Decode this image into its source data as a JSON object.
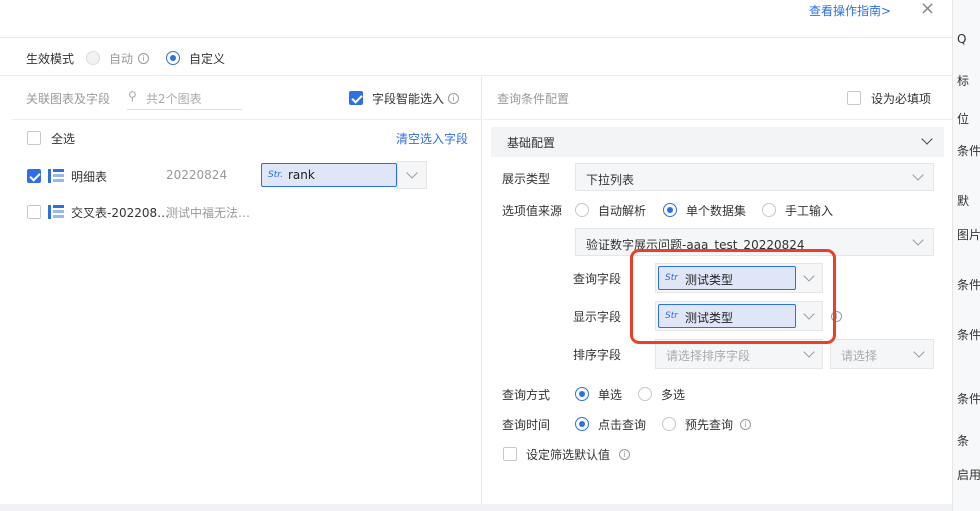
{
  "header": {
    "guide_link": "查看操作指南>",
    "close_icon": "×"
  },
  "mode": {
    "label": "生效模式",
    "option_auto": "自动",
    "option_custom": "自定义"
  },
  "left": {
    "title": "关联图表及字段",
    "search_placeholder": "共2个图表",
    "smart_select": "字段智能选入",
    "select_all": "全选",
    "clear": "清空选入字段",
    "charts": [
      {
        "name": "明细表",
        "date": "20220824",
        "field_type": "Str.",
        "field": "rank"
      },
      {
        "name": "交叉表-202208…",
        "date": "测试中福无法…"
      }
    ]
  },
  "right": {
    "title": "查询条件配置",
    "required": "设为必填项",
    "section": "基础配置",
    "display_type_label": "展示类型",
    "display_type_value": "下拉列表",
    "source_label": "选项值来源",
    "source_options": [
      "自动解析",
      "单个数据集",
      "手工输入"
    ],
    "dataset": "验证数字展示问题-aaa_test_20220824",
    "query_field_label": "查询字段",
    "query_field_value": "测试类型",
    "display_field_label": "显示字段",
    "display_field_value": "测试类型",
    "sort_field_label": "排序字段",
    "sort_field_placeholder": "请选择排序字段",
    "sort_order_placeholder": "请选择",
    "query_mode_label": "查询方式",
    "query_mode_options": [
      "单选",
      "多选"
    ],
    "query_time_label": "查询时间",
    "query_time_options": [
      "点击查询",
      "预先查询"
    ],
    "default_value": "设定筛选默认值"
  },
  "side_panel": {
    "items": [
      "Q",
      "标",
      "位",
      "条件在",
      "默",
      "图片高",
      "条件排",
      "条件",
      "条件间",
      "条",
      "启用风"
    ]
  }
}
